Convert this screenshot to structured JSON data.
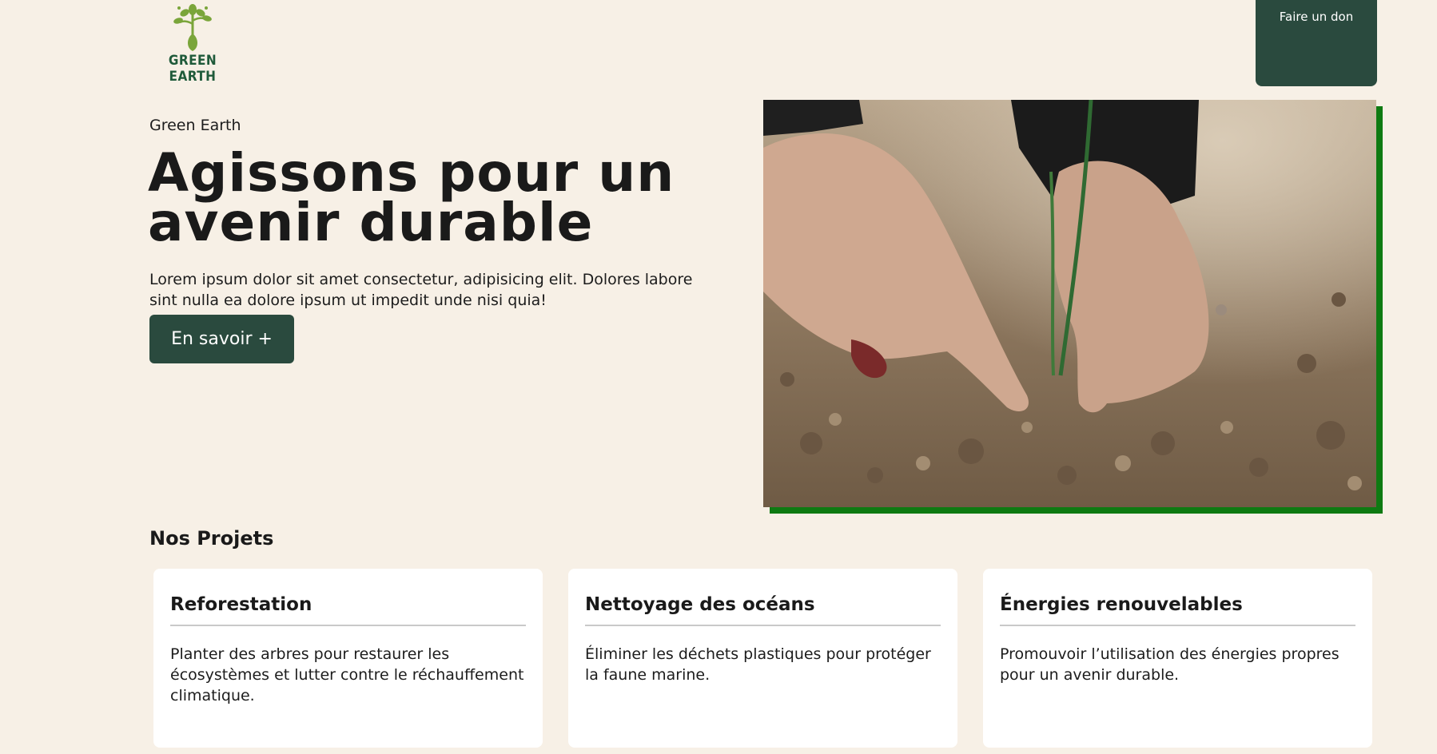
{
  "header": {
    "logo_text": "GREEN EARTH",
    "donate_label": "Faire un don"
  },
  "hero": {
    "eyebrow": "Green Earth",
    "title": "Agissons pour un avenir durable",
    "text": "Lorem ipsum dolor sit amet consectetur, adipisicing elit. Dolores labore sint nulla ea dolore ipsum ut impedit unde nisi quia!",
    "cta_label": "En savoir +"
  },
  "projects": {
    "title": "Nos Projets",
    "cards": [
      {
        "title": "Reforestation",
        "text": "Planter des arbres pour restaurer les écosystèmes et lutter contre le réchauffement climatique."
      },
      {
        "title": "Nettoyage des océans",
        "text": "Éliminer les déchets plastiques pour protéger la faune marine."
      },
      {
        "title": "Énergies renouvelables",
        "text": "Promouvoir l’utilisation des énergies propres pour un avenir durable."
      }
    ]
  },
  "colors": {
    "background": "#f7f0e6",
    "primary": "#2a4a3e",
    "accent": "#0e7a12",
    "logo_green": "#7aa53a"
  },
  "icons": {
    "logo": "sprout-icon"
  }
}
